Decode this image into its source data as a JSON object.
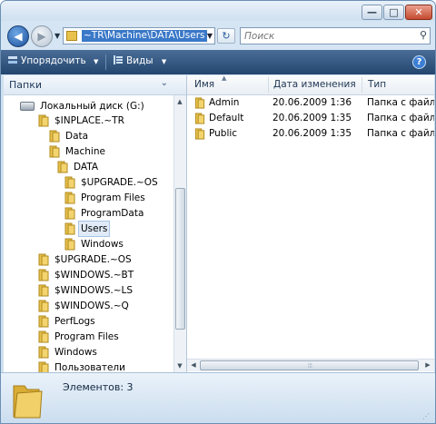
{
  "titlebar": {
    "minimize_glyph": "—",
    "maximize_glyph": "□",
    "close_glyph": "✕"
  },
  "address": {
    "path": "~TR\\Machine\\DATA\\Users",
    "back_glyph": "◀",
    "forward_glyph": "▶",
    "dropdown_glyph": "▼",
    "refresh_glyph": "↻",
    "search_placeholder": "Поиск",
    "search_glyph": "⚲"
  },
  "toolbar": {
    "organize_label": "Упорядочить",
    "views_label": "Виды",
    "dropdown_glyph": "▼",
    "help_glyph": "?"
  },
  "sidebar": {
    "header": "Папки",
    "collapse_glyph": "⌄",
    "items": [
      {
        "label": "Локальный диск (G:)",
        "type": "drive"
      },
      {
        "label": "$INPLACE.~TR",
        "type": "folder"
      },
      {
        "label": "Data",
        "type": "folder"
      },
      {
        "label": "Machine",
        "type": "folder"
      },
      {
        "label": "DATA",
        "type": "folder"
      },
      {
        "label": "$UPGRADE.~OS",
        "type": "folder"
      },
      {
        "label": "Program Files",
        "type": "folder"
      },
      {
        "label": "ProgramData",
        "type": "folder"
      },
      {
        "label": "Users",
        "type": "folder",
        "selected": true
      },
      {
        "label": "Windows",
        "type": "folder"
      },
      {
        "label": "$UPGRADE.~OS",
        "type": "folder"
      },
      {
        "label": "$WINDOWS.~BT",
        "type": "folder"
      },
      {
        "label": "$WINDOWS.~LS",
        "type": "folder"
      },
      {
        "label": "$WINDOWS.~Q",
        "type": "folder"
      },
      {
        "label": "PerfLogs",
        "type": "folder"
      },
      {
        "label": "Program Files",
        "type": "folder"
      },
      {
        "label": "Windows",
        "type": "folder"
      },
      {
        "label": "Пользователи",
        "type": "folder"
      }
    ]
  },
  "file_list": {
    "columns": [
      "Имя",
      "Дата изменения",
      "Тип"
    ],
    "sort_glyph": "▲",
    "rows": [
      {
        "name": "Admin",
        "date": "20.06.2009 1:36",
        "type": "Папка с файлами"
      },
      {
        "name": "Default",
        "date": "20.06.2009 1:35",
        "type": "Папка с файлами"
      },
      {
        "name": "Public",
        "date": "20.06.2009 1:35",
        "type": "Папка с файлами"
      }
    ]
  },
  "details": {
    "item_count": "Элементов: 3"
  },
  "colors": {
    "folder": "#e9c24d",
    "toolbar": "#2f527c",
    "selection": "#3a78c8"
  }
}
